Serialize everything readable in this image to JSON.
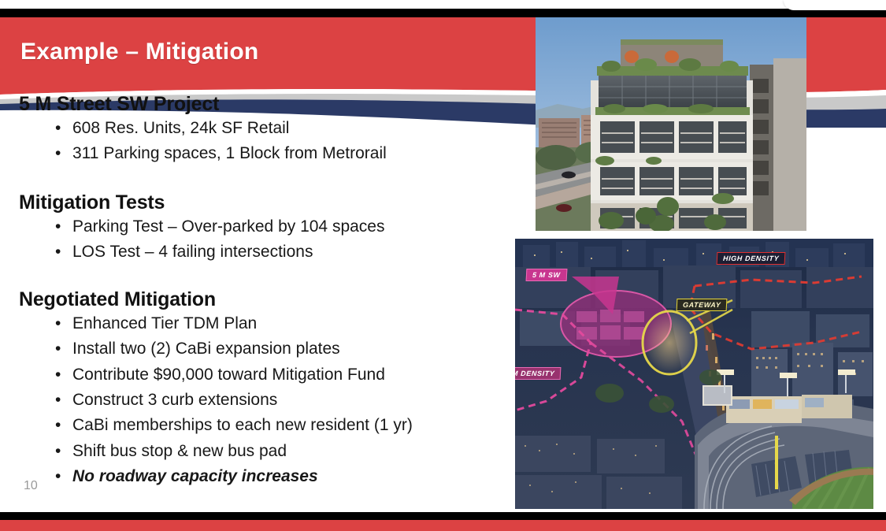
{
  "slide": {
    "title": "Example – Mitigation",
    "page_number": "10",
    "accent_red": "#dc4243",
    "accent_navy": "#2b3a66",
    "accent_gray": "#c9c9c9",
    "title_color": "#ffffff",
    "body_color": "#181818"
  },
  "sections": [
    {
      "heading": "5 M Street SW Project",
      "bullets": [
        {
          "text": "608 Res. Units, 24k SF Retail",
          "emphasis": "none"
        },
        {
          "text": "311 Parking spaces, 1 Block from Metrorail",
          "emphasis": "none"
        }
      ]
    },
    {
      "heading": "Mitigation Tests",
      "bullets": [
        {
          "text": "Parking Test – Over-parked by 104 spaces",
          "emphasis": "none"
        },
        {
          "text": "LOS Test – 4 failing intersections",
          "emphasis": "none"
        }
      ]
    },
    {
      "heading": "Negotiated Mitigation",
      "bullets": [
        {
          "text": "Enhanced Tier TDM Plan",
          "emphasis": "none"
        },
        {
          "text": "Install two (2) CaBi expansion plates",
          "emphasis": "none"
        },
        {
          "text": "Contribute $90,000 toward Mitigation Fund",
          "emphasis": "none"
        },
        {
          "text": "Construct 3 curb extensions",
          "emphasis": "none"
        },
        {
          "text": "CaBi memberships to each new resident (1 yr)",
          "emphasis": "none"
        },
        {
          "text": "Shift bus stop & new bus pad",
          "emphasis": "none"
        },
        {
          "text": "No roadway capacity increases",
          "emphasis": "bold-italic"
        }
      ]
    }
  ],
  "bullet_glyph": "•",
  "images": {
    "building": {
      "name": "building-rendering-photo",
      "alt": "Architectural rendering of a multi-story residential building with rooftop garden under blue sky"
    },
    "aerial": {
      "name": "aerial-night-map-photo",
      "alt": "Aerial night photo of Washington DC Capitol Riverfront with annotated density zones and ballpark",
      "callouts": [
        {
          "label": "5 M SW",
          "style": "pink"
        },
        {
          "label": "HIGH DENSITY",
          "style": "red"
        },
        {
          "label": "GATEWAY",
          "style": "yellow"
        },
        {
          "label": "M DENSITY",
          "style": "pink2"
        }
      ]
    }
  }
}
